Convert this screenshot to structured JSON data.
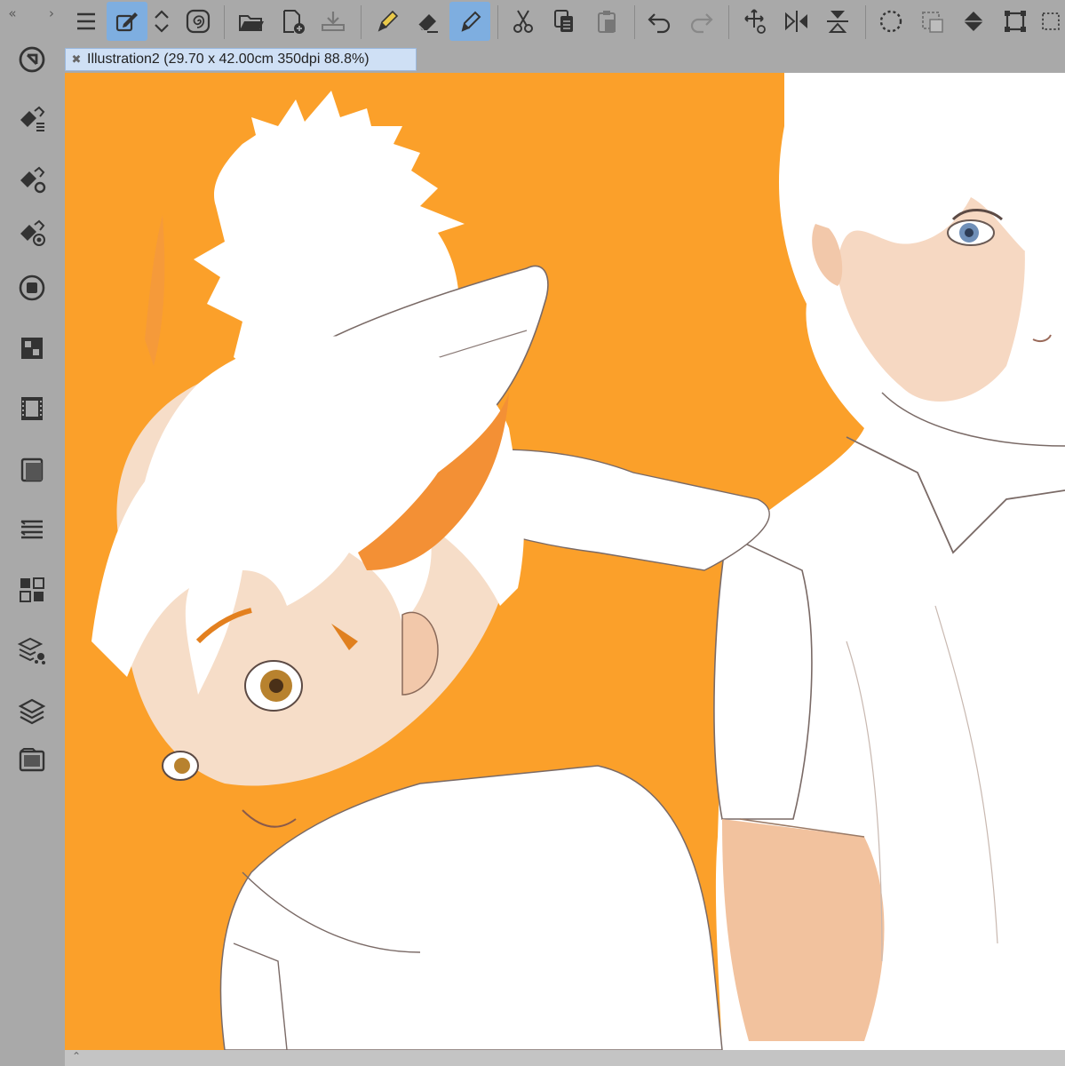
{
  "window": {
    "document_tab": {
      "close_glyph": "✖",
      "title": "Illustration2 (29.70 x 42.00cm 350dpi 88.8%)"
    }
  },
  "toolbar": {
    "collapse_glyph": "«",
    "expand_glyph": "›",
    "active_color": "#7eaee0",
    "buttons": [
      {
        "name": "menu-icon",
        "active": false
      },
      {
        "name": "edit-tool-icon",
        "active": true
      },
      {
        "name": "chevron-up-down-icon",
        "active": false
      },
      {
        "name": "spiral-icon",
        "active": false
      },
      {
        "name": "open-folder-icon",
        "active": false
      },
      {
        "name": "new-canvas-icon",
        "active": false
      },
      {
        "name": "save-icon",
        "active": false
      },
      {
        "name": "pen-icon",
        "active": false
      },
      {
        "name": "eraser-icon",
        "active": false
      },
      {
        "name": "marker-icon",
        "active": true
      },
      {
        "name": "cut-icon",
        "active": false
      },
      {
        "name": "copy-icon",
        "active": false
      },
      {
        "name": "paste-icon",
        "active": false
      },
      {
        "name": "undo-icon",
        "active": false
      },
      {
        "name": "redo-icon",
        "active": false
      },
      {
        "name": "transform-icon",
        "active": false
      },
      {
        "name": "flip-horizontal-icon",
        "active": false
      },
      {
        "name": "flip-vertical-icon",
        "active": false
      },
      {
        "name": "select-all-icon",
        "active": false
      },
      {
        "name": "deselect-icon",
        "active": false
      },
      {
        "name": "fill-icon",
        "active": false
      },
      {
        "name": "crop-icon",
        "active": false
      },
      {
        "name": "selection-icon",
        "active": false
      }
    ]
  },
  "sidebar": {
    "buttons": [
      "quick-access-icon",
      "brush-list-icon",
      "brush-settings-icon",
      "brush-detail-icon",
      "color-circle-icon",
      "color-grid-icon",
      "film-icon",
      "layer-frame-icon",
      "layer-property-icon",
      "node-icon",
      "layer-settings-icon",
      "layers-icon",
      "gallery-icon"
    ]
  },
  "canvas": {
    "background_color": "#fba02a"
  },
  "bottombar": {
    "chevron_glyph": "⌃"
  }
}
